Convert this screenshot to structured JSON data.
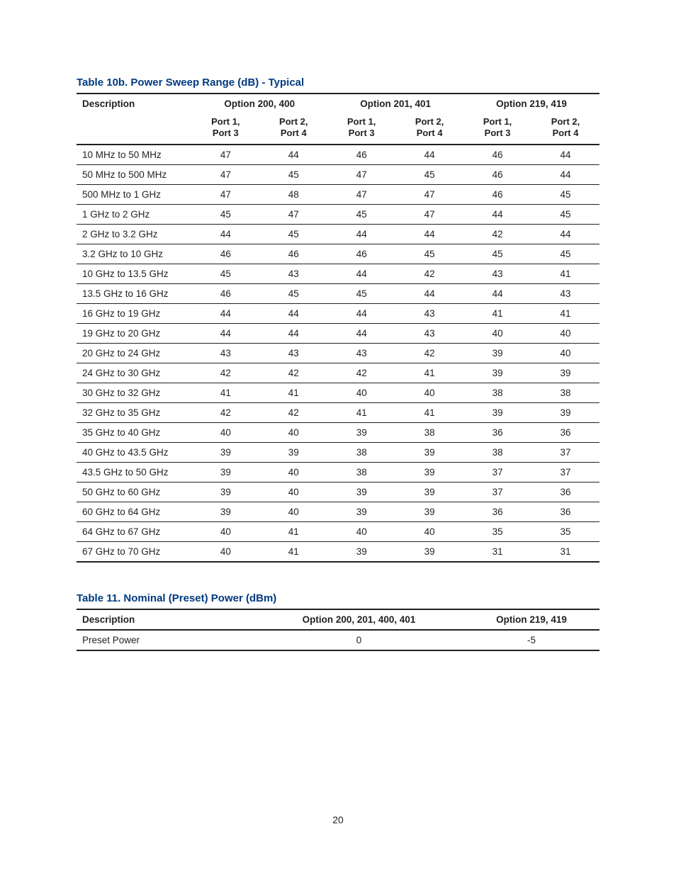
{
  "table10b": {
    "caption": "Table 10b. Power Sweep Range (dB) - Typical",
    "header": {
      "desc": "Description",
      "groups": [
        "Option 200, 400",
        "Option 201, 401",
        "Option 219, 419"
      ],
      "sub": {
        "a": "Port 1,",
        "b": "Port 3",
        "c": "Port 2,",
        "d": "Port 4"
      }
    },
    "rows": [
      {
        "desc": "10 MHz to 50 MHz",
        "v": [
          "47",
          "44",
          "46",
          "44",
          "46",
          "44"
        ]
      },
      {
        "desc": "50 MHz to 500 MHz",
        "v": [
          "47",
          "45",
          "47",
          "45",
          "46",
          "44"
        ]
      },
      {
        "desc": "500 MHz to 1 GHz",
        "v": [
          "47",
          "48",
          "47",
          "47",
          "46",
          "45"
        ]
      },
      {
        "desc": "1 GHz to 2 GHz",
        "v": [
          "45",
          "47",
          "45",
          "47",
          "44",
          "45"
        ]
      },
      {
        "desc": "2 GHz to 3.2 GHz",
        "v": [
          "44",
          "45",
          "44",
          "44",
          "42",
          "44"
        ]
      },
      {
        "desc": "3.2 GHz to 10 GHz",
        "v": [
          "46",
          "46",
          "46",
          "45",
          "45",
          "45"
        ]
      },
      {
        "desc": "10 GHz to 13.5 GHz",
        "v": [
          "45",
          "43",
          "44",
          "42",
          "43",
          "41"
        ]
      },
      {
        "desc": "13.5 GHz to 16 GHz",
        "v": [
          "46",
          "45",
          "45",
          "44",
          "44",
          "43"
        ]
      },
      {
        "desc": "16 GHz to 19 GHz",
        "v": [
          "44",
          "44",
          "44",
          "43",
          "41",
          "41"
        ]
      },
      {
        "desc": "19 GHz to 20 GHz",
        "v": [
          "44",
          "44",
          "44",
          "43",
          "40",
          "40"
        ]
      },
      {
        "desc": "20 GHz to 24 GHz",
        "v": [
          "43",
          "43",
          "43",
          "42",
          "39",
          "40"
        ]
      },
      {
        "desc": "24 GHz to 30 GHz",
        "v": [
          "42",
          "42",
          "42",
          "41",
          "39",
          "39"
        ]
      },
      {
        "desc": "30 GHz to 32 GHz",
        "v": [
          "41",
          "41",
          "40",
          "40",
          "38",
          "38"
        ]
      },
      {
        "desc": "32 GHz to 35 GHz",
        "v": [
          "42",
          "42",
          "41",
          "41",
          "39",
          "39"
        ]
      },
      {
        "desc": "35 GHz to 40 GHz",
        "v": [
          "40",
          "40",
          "39",
          "38",
          "36",
          "36"
        ]
      },
      {
        "desc": "40 GHz to 43.5 GHz",
        "v": [
          "39",
          "39",
          "38",
          "39",
          "38",
          "37"
        ]
      },
      {
        "desc": "43.5 GHz to 50 GHz",
        "v": [
          "39",
          "40",
          "38",
          "39",
          "37",
          "37"
        ]
      },
      {
        "desc": "50 GHz to 60 GHz",
        "v": [
          "39",
          "40",
          "39",
          "39",
          "37",
          "36"
        ]
      },
      {
        "desc": "60 GHz to 64 GHz",
        "v": [
          "39",
          "40",
          "39",
          "39",
          "36",
          "36"
        ]
      },
      {
        "desc": "64 GHz to 67 GHz",
        "v": [
          "40",
          "41",
          "40",
          "40",
          "35",
          "35"
        ]
      },
      {
        "desc": "67 GHz to 70 GHz",
        "v": [
          "40",
          "41",
          "39",
          "39",
          "31",
          "31"
        ]
      }
    ]
  },
  "table11": {
    "caption": "Table 11. Nominal (Preset) Power (dBm)",
    "header": {
      "desc": "Description",
      "col1": "Option 200, 201, 400, 401",
      "col2": "Option 219, 419"
    },
    "rows": [
      {
        "desc": "Preset Power",
        "col1": "0",
        "col2": "-5"
      }
    ]
  },
  "page": "20"
}
